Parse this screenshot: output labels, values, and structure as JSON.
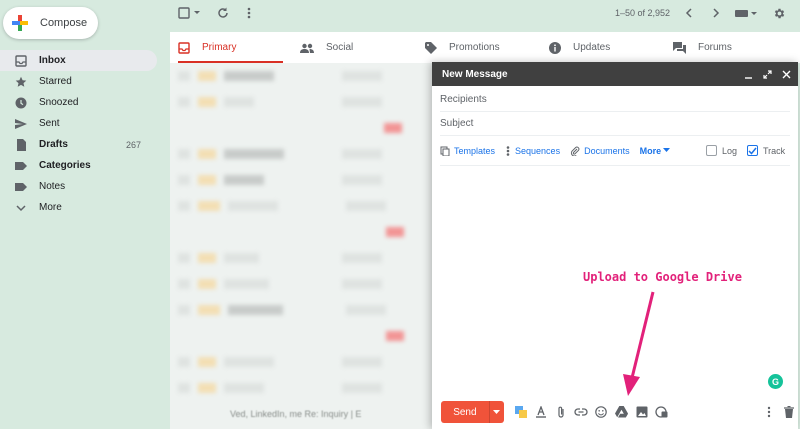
{
  "sidebar": {
    "compose_label": "Compose",
    "items": [
      {
        "label": "Inbox",
        "count": ""
      },
      {
        "label": "Starred",
        "count": ""
      },
      {
        "label": "Snoozed",
        "count": ""
      },
      {
        "label": "Sent",
        "count": ""
      },
      {
        "label": "Drafts",
        "count": "267"
      },
      {
        "label": "Categories",
        "count": ""
      },
      {
        "label": "Notes",
        "count": ""
      },
      {
        "label": "More",
        "count": ""
      }
    ]
  },
  "toolbar": {
    "pager": "1–50 of 2,952"
  },
  "tabs": [
    {
      "label": "Primary"
    },
    {
      "label": "Social"
    },
    {
      "label": "Promotions"
    },
    {
      "label": "Updates"
    },
    {
      "label": "Forums"
    }
  ],
  "compose": {
    "title": "New Message",
    "recipients_placeholder": "Recipients",
    "subject_placeholder": "Subject",
    "extensions": {
      "templates": "Templates",
      "sequences": "Sequences",
      "documents": "Documents",
      "more": "More",
      "log": "Log",
      "track": "Track"
    },
    "send_label": "Send"
  },
  "annotation": {
    "text": "Upload to Google Drive"
  },
  "list_footer": "Ved, LinkedIn, me  Re: Inquiry | E",
  "colors": {
    "accent": "#d93025",
    "send": "#f0533a",
    "annotation": "#e2217a",
    "background": "#d7eadf"
  }
}
